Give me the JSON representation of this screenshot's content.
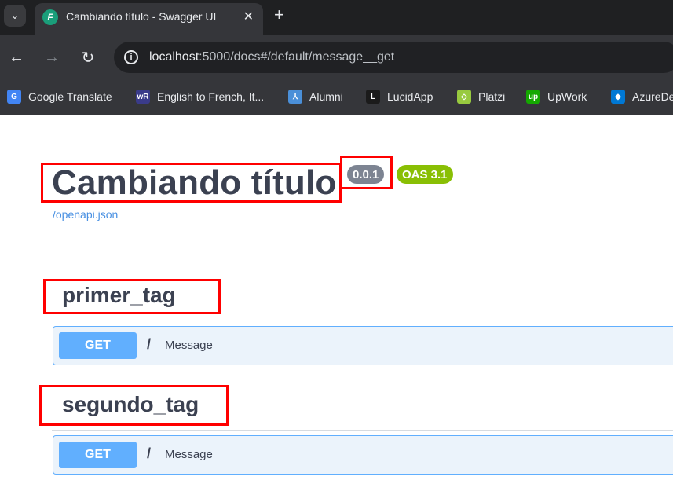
{
  "browser": {
    "tab": {
      "title": "Cambiando título - Swagger UI",
      "favicon_letter": "F",
      "close_glyph": "✕"
    },
    "new_tab_glyph": "+",
    "menu_glyph": "⌄",
    "nav": {
      "back_glyph": "←",
      "forward_glyph": "→",
      "reload_glyph": "↻"
    },
    "url": {
      "host": "localhost",
      "rest": ":5000/docs#/default/message__get"
    },
    "bookmarks": [
      {
        "label": "Google Translate",
        "icon": "google-translate-icon",
        "icon_text": "G",
        "color": "#4285f4"
      },
      {
        "label": "English to French, It...",
        "icon": "wordreference-icon",
        "icon_text": "wR",
        "color": "#3a3b8a"
      },
      {
        "label": "Alumni",
        "icon": "alumni-icon",
        "icon_text": "⅄",
        "color": "#4a8fd8"
      },
      {
        "label": "LucidApp",
        "icon": "lucid-icon",
        "icon_text": "L",
        "color": "#1b1b1b"
      },
      {
        "label": "Platzi",
        "icon": "platzi-icon",
        "icon_text": "◇",
        "color": "#98ca3f"
      },
      {
        "label": "UpWork",
        "icon": "upwork-icon",
        "icon_text": "up",
        "color": "#14a800"
      },
      {
        "label": "AzureDe",
        "icon": "azure-devops-icon",
        "icon_text": "◆",
        "color": "#0078d4"
      }
    ]
  },
  "swagger": {
    "title": "Cambiando título",
    "version": "0.0.1",
    "oas": "OAS 3.1",
    "spec_link": "/openapi.json",
    "tags": [
      {
        "name": "primer_tag",
        "operations": [
          {
            "method": "GET",
            "path": "/",
            "summary": "Message"
          }
        ]
      },
      {
        "name": "segundo_tag",
        "operations": [
          {
            "method": "GET",
            "path": "/",
            "summary": "Message"
          }
        ]
      }
    ]
  },
  "colors": {
    "highlight": "#ff0000",
    "get_method": "#61affe",
    "version_badge": "#7d8492",
    "oas_badge": "#89bf04"
  }
}
